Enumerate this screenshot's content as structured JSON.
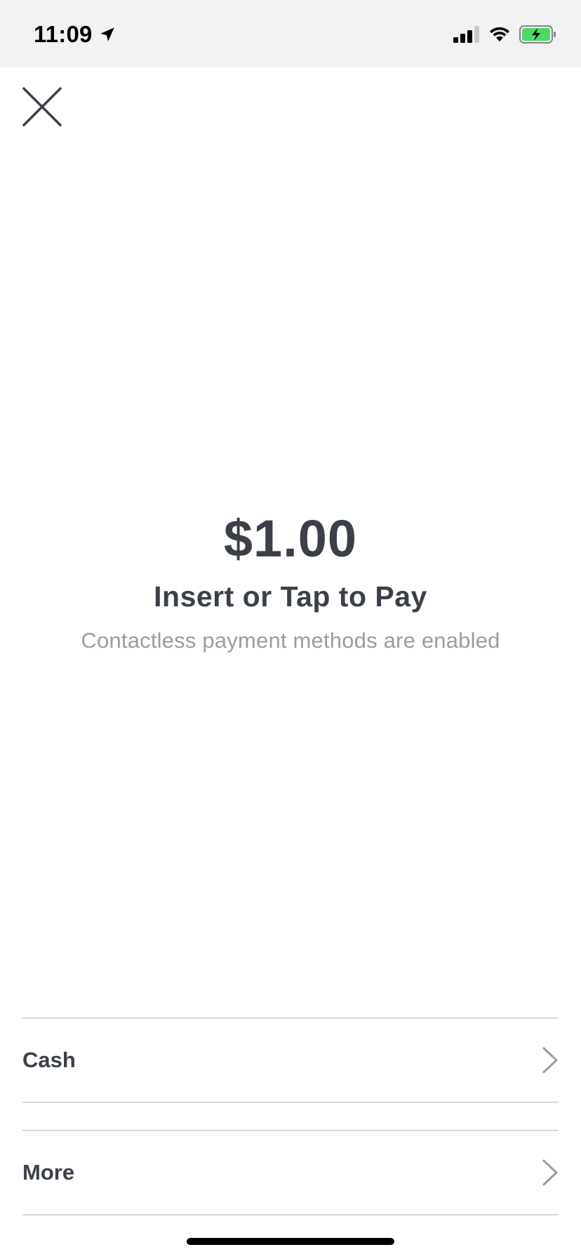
{
  "status_bar": {
    "time": "11:09",
    "icons": [
      "location-arrow-icon",
      "signal-icon",
      "wifi-icon",
      "battery-charging-icon"
    ],
    "battery_color": "#4cd964"
  },
  "header": {
    "close_icon": "close-icon"
  },
  "payment": {
    "amount": "$1.00",
    "prompt": "Insert or Tap to Pay",
    "subtitle": "Contactless payment methods are enabled"
  },
  "options": [
    {
      "label": "Cash",
      "icon": "chevron-right-icon"
    },
    {
      "label": "More",
      "icon": "chevron-right-icon"
    }
  ],
  "colors": {
    "text_primary": "#3b4048",
    "text_secondary": "#9a9ca1",
    "divider": "#d7d8da",
    "status_bar_bg": "#f1f2f4"
  }
}
